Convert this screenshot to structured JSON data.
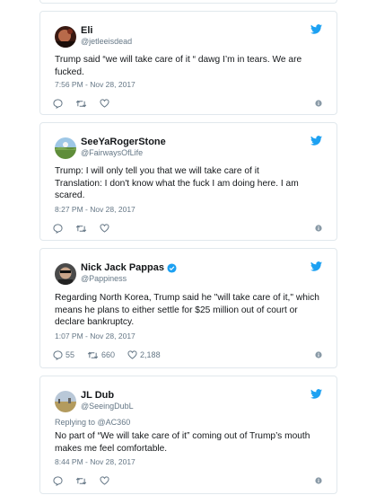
{
  "tweets": [
    {
      "name": "Eli",
      "handle": "@jetleeisdead",
      "text": "Trump said “we will take care of it “ dawg I’m in tears. We are fucked.",
      "time": "7:56 PM - Nov 28, 2017",
      "verified": false,
      "replies": "",
      "retweets": "",
      "likes": ""
    },
    {
      "name": "SeeYaRogerStone",
      "handle": "@FairwaysOfLife",
      "text": "Trump: I will only tell you that we will take care of it\nTranslation: I don't know what the fuck I am doing here. I am scared.",
      "time": "8:27 PM - Nov 28, 2017",
      "verified": false,
      "replies": "",
      "retweets": "",
      "likes": ""
    },
    {
      "name": "Nick Jack Pappas",
      "handle": "@Pappiness",
      "text": "Regarding North Korea, Trump said he \"will take care of it,\" which means he plans to either settle for $25 million out of court or declare bankruptcy.",
      "time": "1:07 PM - Nov 28, 2017",
      "verified": true,
      "replies": "55",
      "retweets": "660",
      "likes": "2,188"
    },
    {
      "name": "JL Dub",
      "handle": "@SeeingDubL",
      "reply_to_label": "Replying to",
      "reply_to_handle": "@AC360",
      "text": "No part of “We will take care of it” coming out of Trump’s mouth makes me feel comfortable.",
      "time": "8:44 PM - Nov 28, 2017",
      "verified": false,
      "replies": "",
      "retweets": "",
      "likes": ""
    }
  ],
  "colors": {
    "twitter_blue": "#1da1f2",
    "muted": "#657786",
    "border": "#e1e8ed"
  },
  "icons": [
    "twitter-bird-icon",
    "reply-icon",
    "retweet-icon",
    "like-icon",
    "info-icon",
    "verified-badge-icon"
  ]
}
